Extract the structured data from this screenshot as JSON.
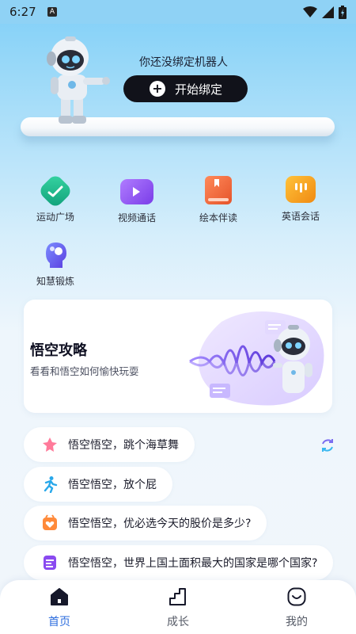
{
  "status_bar": {
    "time": "6:27",
    "notification_badge": "A",
    "icons": [
      "wifi-icon",
      "signal-icon",
      "battery-icon"
    ]
  },
  "bind_card": {
    "title": "你还没绑定机器人",
    "button_label": "开始绑定"
  },
  "features": [
    {
      "label": "运动广场",
      "icon": "sports-icon",
      "color": "#19b58a"
    },
    {
      "label": "视频通话",
      "icon": "video-call-icon",
      "color": "#8a4af0"
    },
    {
      "label": "绘本伴读",
      "icon": "picture-book-icon",
      "color": "#f0683a"
    },
    {
      "label": "英语会话",
      "icon": "english-chat-icon",
      "color": "#f4a11a"
    },
    {
      "label": "知慧锻炼",
      "icon": "brain-icon",
      "color": "#6a56f0"
    }
  ],
  "guide_card": {
    "title": "悟空攻略",
    "subtitle": "看看和悟空如何愉快玩耍"
  },
  "suggestions": [
    {
      "text": "悟空悟空，跳个海草舞",
      "icon": "dance-icon"
    },
    {
      "text": "悟空悟空，放个屁",
      "icon": "run-icon"
    },
    {
      "text": "悟空悟空，优必选今天的股价是多少?",
      "icon": "stock-icon"
    },
    {
      "text": "悟空悟空，世界上国土面积最大的国家是哪个国家?",
      "icon": "note-icon"
    }
  ],
  "nav": [
    {
      "label": "首页",
      "icon": "home-icon",
      "active": true
    },
    {
      "label": "成长",
      "icon": "growth-icon",
      "active": false
    },
    {
      "label": "我的",
      "icon": "profile-icon",
      "active": false
    }
  ],
  "colors": {
    "accent": "#2d6dde",
    "button_dark": "#11121a",
    "bg_top": "#7fcff7"
  }
}
